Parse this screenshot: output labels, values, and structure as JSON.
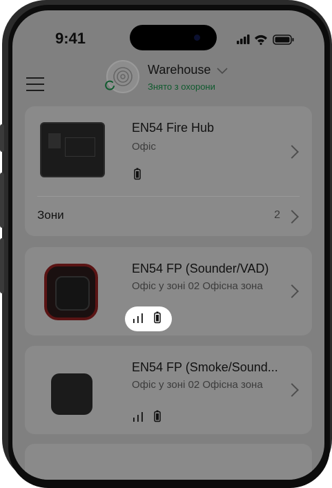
{
  "status_bar": {
    "time": "9:41"
  },
  "header": {
    "hub_name": "Warehouse",
    "hub_status": "Знято з охорони"
  },
  "devices": [
    {
      "name": "EN54 Fire Hub",
      "location": "Офіс",
      "zones_label": "Зони",
      "zones_count": "2"
    },
    {
      "name": "EN54 FP (Sounder/VAD)",
      "location": "Офіс у зоні 02 Офісна зона"
    },
    {
      "name": "EN54 FP (Smoke/Sound...",
      "location": "Офіс у зоні 02 Офісна зона"
    }
  ],
  "colors": {
    "overlay_gray": "#808080",
    "status_green": "#0f5a2e",
    "highlight": "#ffffff"
  }
}
